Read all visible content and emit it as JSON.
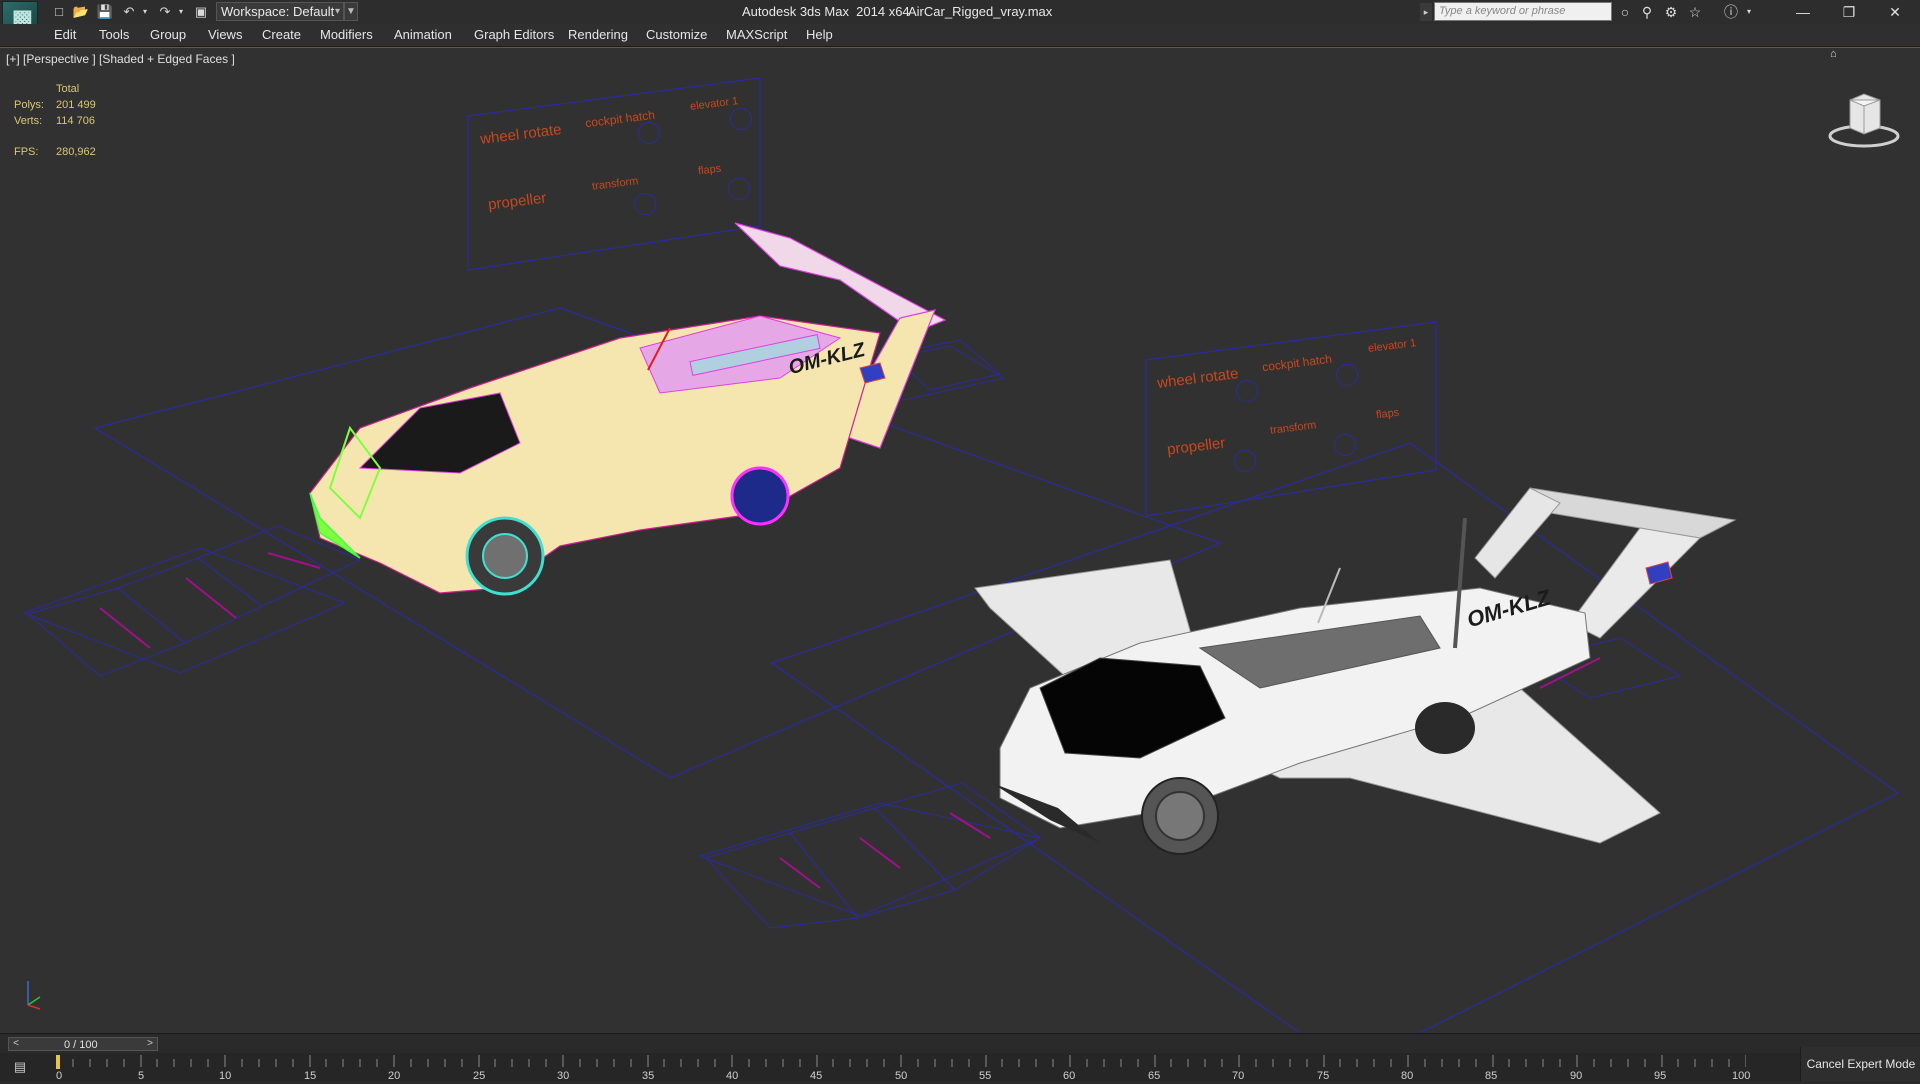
{
  "titlebar": {
    "workspace_label": "Workspace: Default",
    "app_title": "Autodesk 3ds Max  2014 x64",
    "file_name": "AirCar_Rigged_vray.max",
    "search_placeholder": "Type a keyword or phrase"
  },
  "menu": {
    "items": [
      "Edit",
      "Tools",
      "Group",
      "Views",
      "Create",
      "Modifiers",
      "Animation",
      "Graph Editors",
      "Rendering",
      "Customize",
      "MAXScript",
      "Help"
    ]
  },
  "viewport": {
    "label": "[+] [Perspective ] [Shaded + Edged Faces ]",
    "stats": {
      "header": "Total",
      "polys_label": "Polys:",
      "polys_value": "201 499",
      "verts_label": "Verts:",
      "verts_value": "114 706",
      "fps_label": "FPS:",
      "fps_value": "280,962"
    },
    "control_panels": [
      {
        "wheel_rotate": "wheel rotate",
        "cockpit_hatch": "cockpit hatch",
        "elevator": "elevator 1",
        "propeller": "propeller",
        "transform": "transform",
        "flaps": "flaps"
      },
      {
        "wheel_rotate": "wheel rotate",
        "cockpit_hatch": "cockpit hatch",
        "elevator": "elevator 1",
        "propeller": "propeller",
        "transform": "transform",
        "flaps": "flaps"
      }
    ],
    "registration": [
      "OM-KLZ",
      "OM-KLZ"
    ]
  },
  "timeline": {
    "frame_text": "0 / 100",
    "ticks": [
      "0",
      "5",
      "10",
      "15",
      "20",
      "25",
      "30",
      "35",
      "40",
      "45",
      "50",
      "55",
      "60",
      "65",
      "70",
      "75",
      "80",
      "85",
      "90",
      "95",
      "100"
    ],
    "expert_button": "Cancel Expert Mode"
  },
  "colors": {
    "accent": "#d9c777",
    "panel_text": "#c8481e",
    "panel_border": "#2a2aa0",
    "wire_pink": "#e040e0",
    "wire_yellow": "#f5e6b0"
  }
}
